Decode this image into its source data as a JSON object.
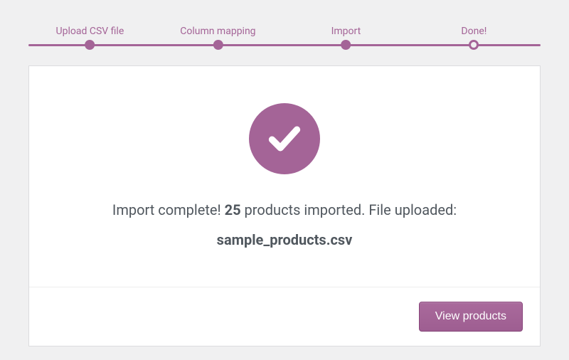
{
  "stepper": {
    "steps": [
      {
        "label": "Upload CSV file",
        "pos": 12
      },
      {
        "label": "Column mapping",
        "pos": 37
      },
      {
        "label": "Import",
        "pos": 62
      },
      {
        "label": "Done!",
        "pos": 87
      }
    ],
    "active_index": 3
  },
  "result": {
    "prefix": "Import complete! ",
    "count": "25",
    "suffix": " products imported. File uploaded:",
    "filename": "sample_products.csv"
  },
  "actions": {
    "view_products": "View products"
  },
  "colors": {
    "accent": "#a46497"
  }
}
